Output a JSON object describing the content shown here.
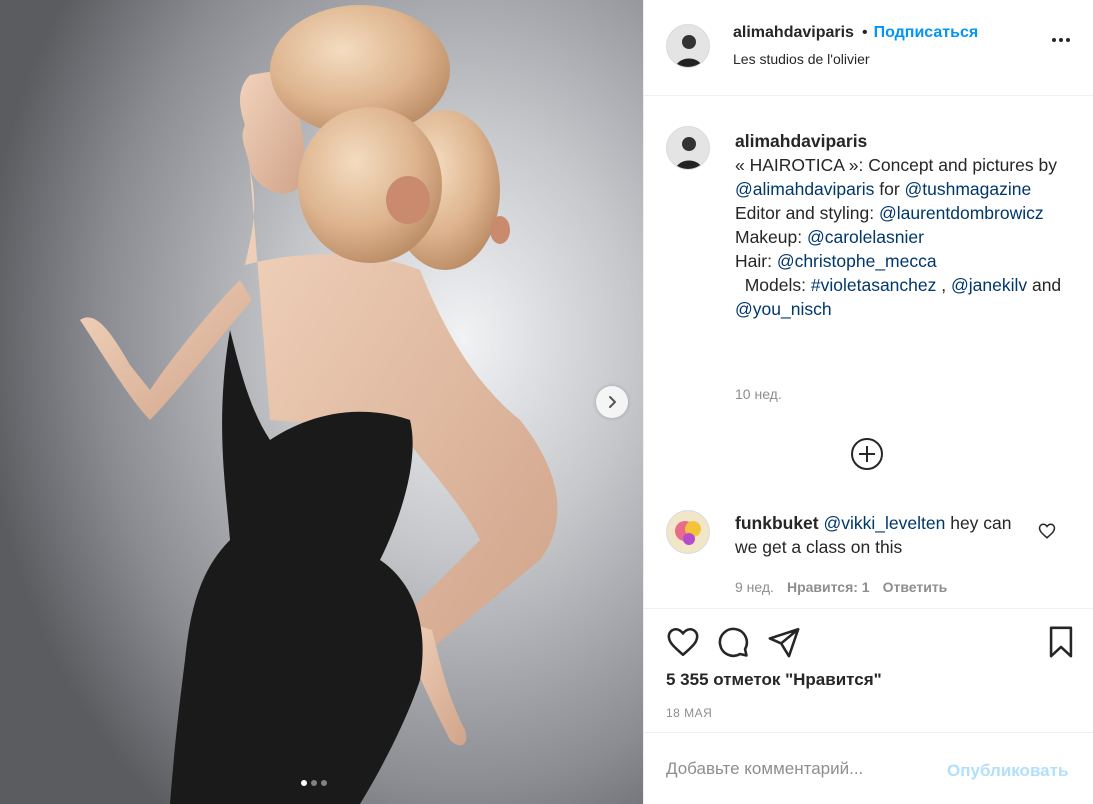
{
  "post": {
    "username": "alimahdaviparis",
    "bullet": "•",
    "follow_label": "Подписаться",
    "location": "Les studios de l'olivier",
    "caption": {
      "username": "alimahdaviparis",
      "t1": "« HAIROTICA »: Concept and pictures by ",
      "m1": "@alimahdaviparis",
      "t2": " for ",
      "m2": "@tushmagazine",
      "t3": "Editor and styling: ",
      "m3": "@laurentdombrowicz",
      "t4": " Makeup: ",
      "m4": "@carolelasnier",
      "t5": "Hair: ",
      "m5": "@christophe_mecca",
      "t6": "  Models: ",
      "m6": "#violetasanchez",
      "t7": " , ",
      "m7": "@janekilv",
      "t8": " and ",
      "m8": "@you_nisch"
    },
    "caption_time": "10 нед."
  },
  "comment": {
    "username": "funkbuket",
    "mention": "@vikki_levelten",
    "text": " hey can we get a class on this",
    "time": "9 нед.",
    "likes": "Нравится: 1",
    "reply": "Ответить"
  },
  "stats": {
    "likes": "5 355 отметок \"Нравится\"",
    "date": "18 МАЯ"
  },
  "add_comment": {
    "placeholder": "Добавьте комментарий...",
    "publish": "Опубликовать"
  },
  "carousel": {
    "total": 3,
    "current": 1
  },
  "icons": {
    "like": "heart-icon",
    "comment": "comment-icon",
    "share": "paper-plane-icon",
    "save": "bookmark-icon",
    "more": "more-options-icon",
    "next": "chevron-right-icon",
    "load_more": "plus-circle-icon"
  },
  "colors": {
    "link": "#0095f6",
    "mention": "#00376b",
    "muted": "#8e8e8e",
    "publish_disabled": "#b2dffc"
  }
}
